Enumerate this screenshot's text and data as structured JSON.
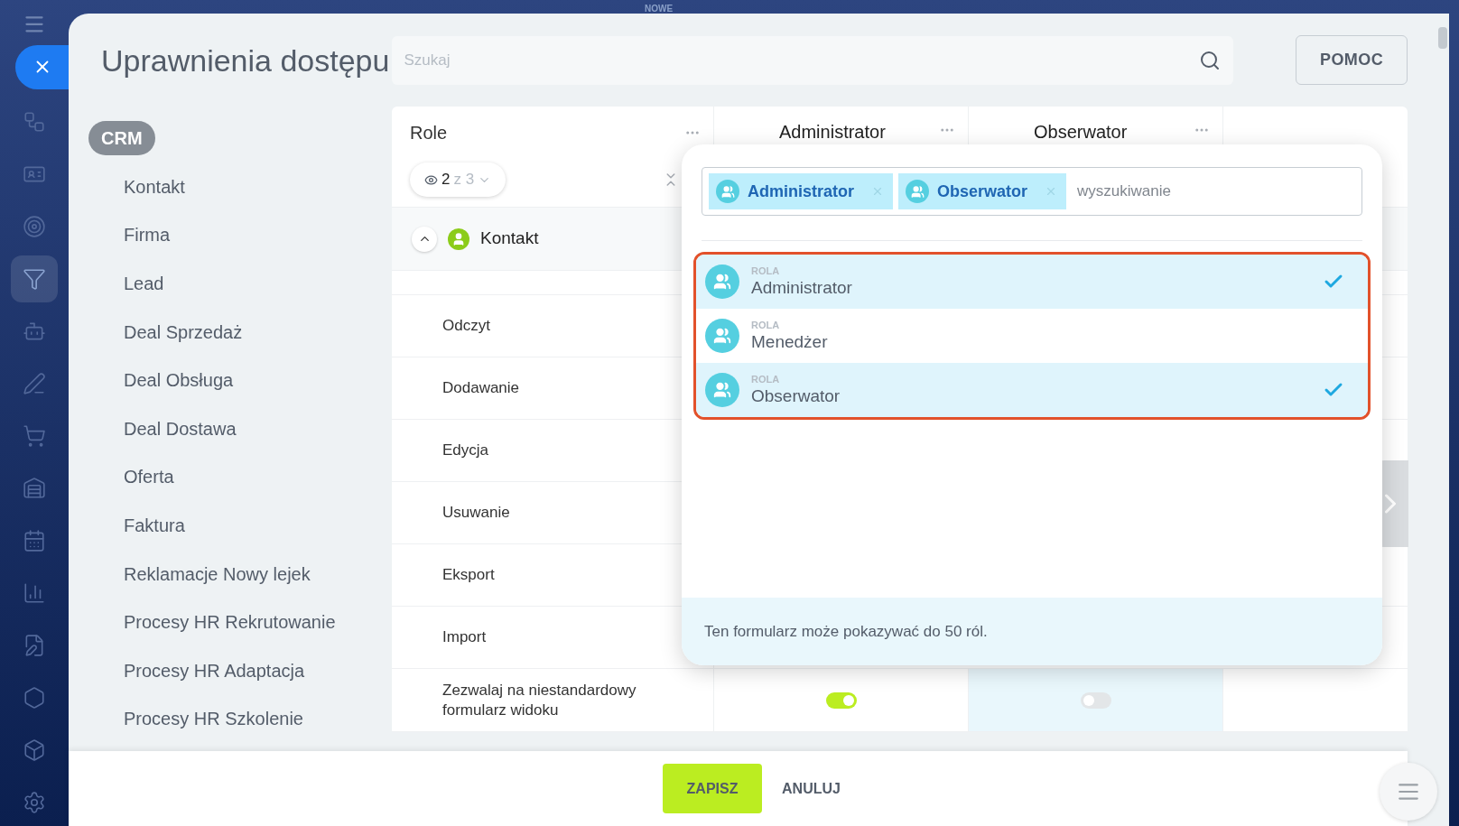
{
  "top_label": "NOWE",
  "rail_items": [
    {
      "selected": false
    },
    {
      "selected": false
    },
    {
      "selected": false
    },
    {
      "selected": true
    },
    {
      "selected": false
    },
    {
      "selected": false
    },
    {
      "selected": false
    },
    {
      "selected": false
    },
    {
      "selected": false
    },
    {
      "selected": false
    },
    {
      "selected": false
    },
    {
      "selected": false
    },
    {
      "selected": false
    },
    {
      "selected": false
    }
  ],
  "title": "Uprawnienia dostępu",
  "search": {
    "placeholder": "Szukaj"
  },
  "help_button": "POMOC",
  "section_badge": "CRM",
  "nav_items": [
    "Kontakt",
    "Firma",
    "Lead",
    "Deal Sprzedaż",
    "Deal Obsługa",
    "Deal Dostawa",
    "Oferta",
    "Faktura",
    "Reklamacje Nowy lejek",
    "Procesy HR Rekrutowanie",
    "Procesy HR Adaptacja",
    "Procesy HR Szkolenie"
  ],
  "table": {
    "role_header": "Role",
    "view_filter": {
      "shown": "2",
      "total": "z 3"
    },
    "columns": [
      {
        "title": "Administrator",
        "highlighted": false
      },
      {
        "title": "Obserwator",
        "highlighted": true
      }
    ],
    "group": {
      "title": "Kontakt",
      "expanded": true
    },
    "rows": [
      {
        "label": "Odczyt"
      },
      {
        "label": "Dodawanie"
      },
      {
        "label": "Edycja"
      },
      {
        "label": "Usuwanie"
      },
      {
        "label": "Eksport"
      },
      {
        "label": "Import"
      }
    ],
    "toggle_row": {
      "label": "Zezwalaj na niestandardowy formularz widoku",
      "toggles": [
        {
          "on": true
        },
        {
          "on": false
        }
      ]
    }
  },
  "popup": {
    "tags": [
      {
        "label": "Administrator"
      },
      {
        "label": "Obserwator"
      }
    ],
    "search_placeholder": "wyszukiwanie",
    "options": [
      {
        "caption": "ROLA",
        "name": "Administrator",
        "selected": true
      },
      {
        "caption": "ROLA",
        "name": "Menedżer",
        "selected": false
      },
      {
        "caption": "ROLA",
        "name": "Obserwator",
        "selected": true
      }
    ],
    "note": "Ten formularz może pokazywać do 50 ról."
  },
  "footer": {
    "save": "ZAPISZ",
    "cancel": "ANULUJ"
  }
}
